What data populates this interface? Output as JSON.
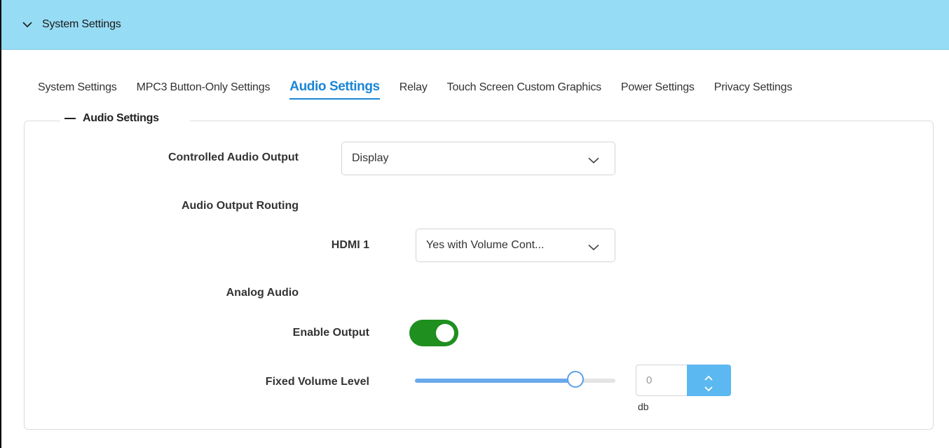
{
  "section": {
    "title": "System Settings"
  },
  "tabs": [
    {
      "label": "System Settings",
      "active": false
    },
    {
      "label": "MPC3 Button-Only Settings",
      "active": false
    },
    {
      "label": "Audio Settings",
      "active": true
    },
    {
      "label": "Relay",
      "active": false
    },
    {
      "label": "Touch Screen Custom Graphics",
      "active": false
    },
    {
      "label": "Power Settings",
      "active": false
    },
    {
      "label": "Privacy Settings",
      "active": false
    }
  ],
  "audio": {
    "legend": "Audio Settings",
    "controlled_output": {
      "label": "Controlled Audio Output",
      "value": "Display"
    },
    "routing_label": "Audio Output Routing",
    "hdmi1": {
      "label": "HDMI 1",
      "value": "Yes with Volume Cont..."
    },
    "analog_label": "Analog Audio",
    "enable_output": {
      "label": "Enable Output",
      "on": true
    },
    "fixed_volume": {
      "label": "Fixed Volume Level",
      "slider_fraction": 0.8,
      "value": "0",
      "unit": "db"
    }
  },
  "colors": {
    "header": "#97dcf5",
    "accent": "#1a86d6",
    "toggle_on": "#1f8f1f",
    "spinner": "#5cb8f0"
  },
  "icons": {
    "header": "chevron-down-icon",
    "select": "chevron-down-icon",
    "spin_up": "chevron-up-icon",
    "spin_down": "chevron-down-icon"
  }
}
